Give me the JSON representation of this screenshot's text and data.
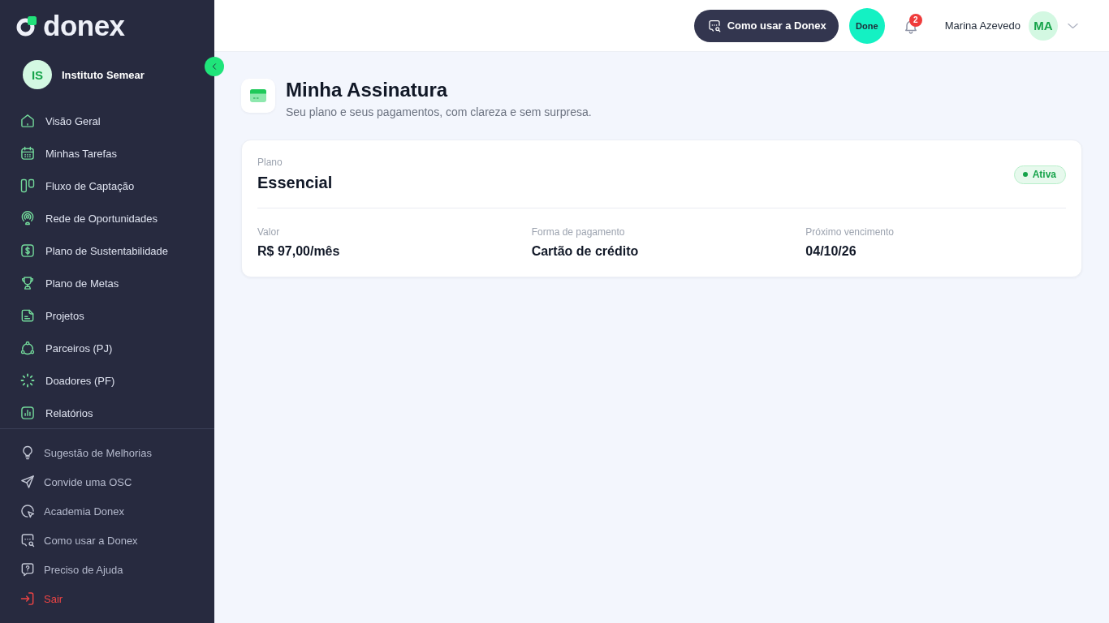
{
  "brand": {
    "name": "donex"
  },
  "organization": {
    "initials": "IS",
    "name": "Instituto Semear"
  },
  "sidebar": {
    "items": [
      {
        "label": "Visão Geral",
        "selected": false
      },
      {
        "label": "Minhas Tarefas",
        "selected": false
      },
      {
        "label": "Fluxo de Captação",
        "selected": false
      },
      {
        "label": "Rede de Oportunidades",
        "selected": false
      },
      {
        "label": "Plano de Sustentabilidade",
        "selected": false
      },
      {
        "label": "Plano de Metas",
        "selected": false
      },
      {
        "label": "Projetos",
        "selected": false
      },
      {
        "label": "Parceiros (PJ)",
        "selected": false
      },
      {
        "label": "Doadores (PF)",
        "selected": false
      },
      {
        "label": "Relatórios",
        "selected": false
      }
    ],
    "footer_items": [
      {
        "label": "Sugestão de Melhorias",
        "kind": "link"
      },
      {
        "label": "Convide uma OSC",
        "kind": "link"
      },
      {
        "label": "Academia Donex",
        "kind": "link"
      },
      {
        "label": "Como usar a Donex",
        "kind": "link"
      },
      {
        "label": "Preciso de Ajuda",
        "kind": "link"
      },
      {
        "label": "Sair",
        "kind": "logout"
      }
    ]
  },
  "topbar": {
    "help_button": "Como usar a Donex",
    "done_button": "Done",
    "notifications": {
      "count": "2"
    },
    "user": {
      "name": "Marina Azevedo",
      "initials": "MA"
    }
  },
  "page": {
    "title": "Minha Assinatura",
    "subtitle": "Seu plano e seus pagamentos, com clareza e sem surpresa."
  },
  "plan": {
    "label": "Plano",
    "name": "Essencial",
    "status": "Ativa",
    "details": [
      {
        "label": "Valor",
        "value": "R$ 97,00/mês"
      },
      {
        "label": "Forma de pagamento",
        "value": "Cartão de crédito"
      },
      {
        "label": "Próximo vencimento",
        "value": "04/10/26"
      }
    ]
  }
}
